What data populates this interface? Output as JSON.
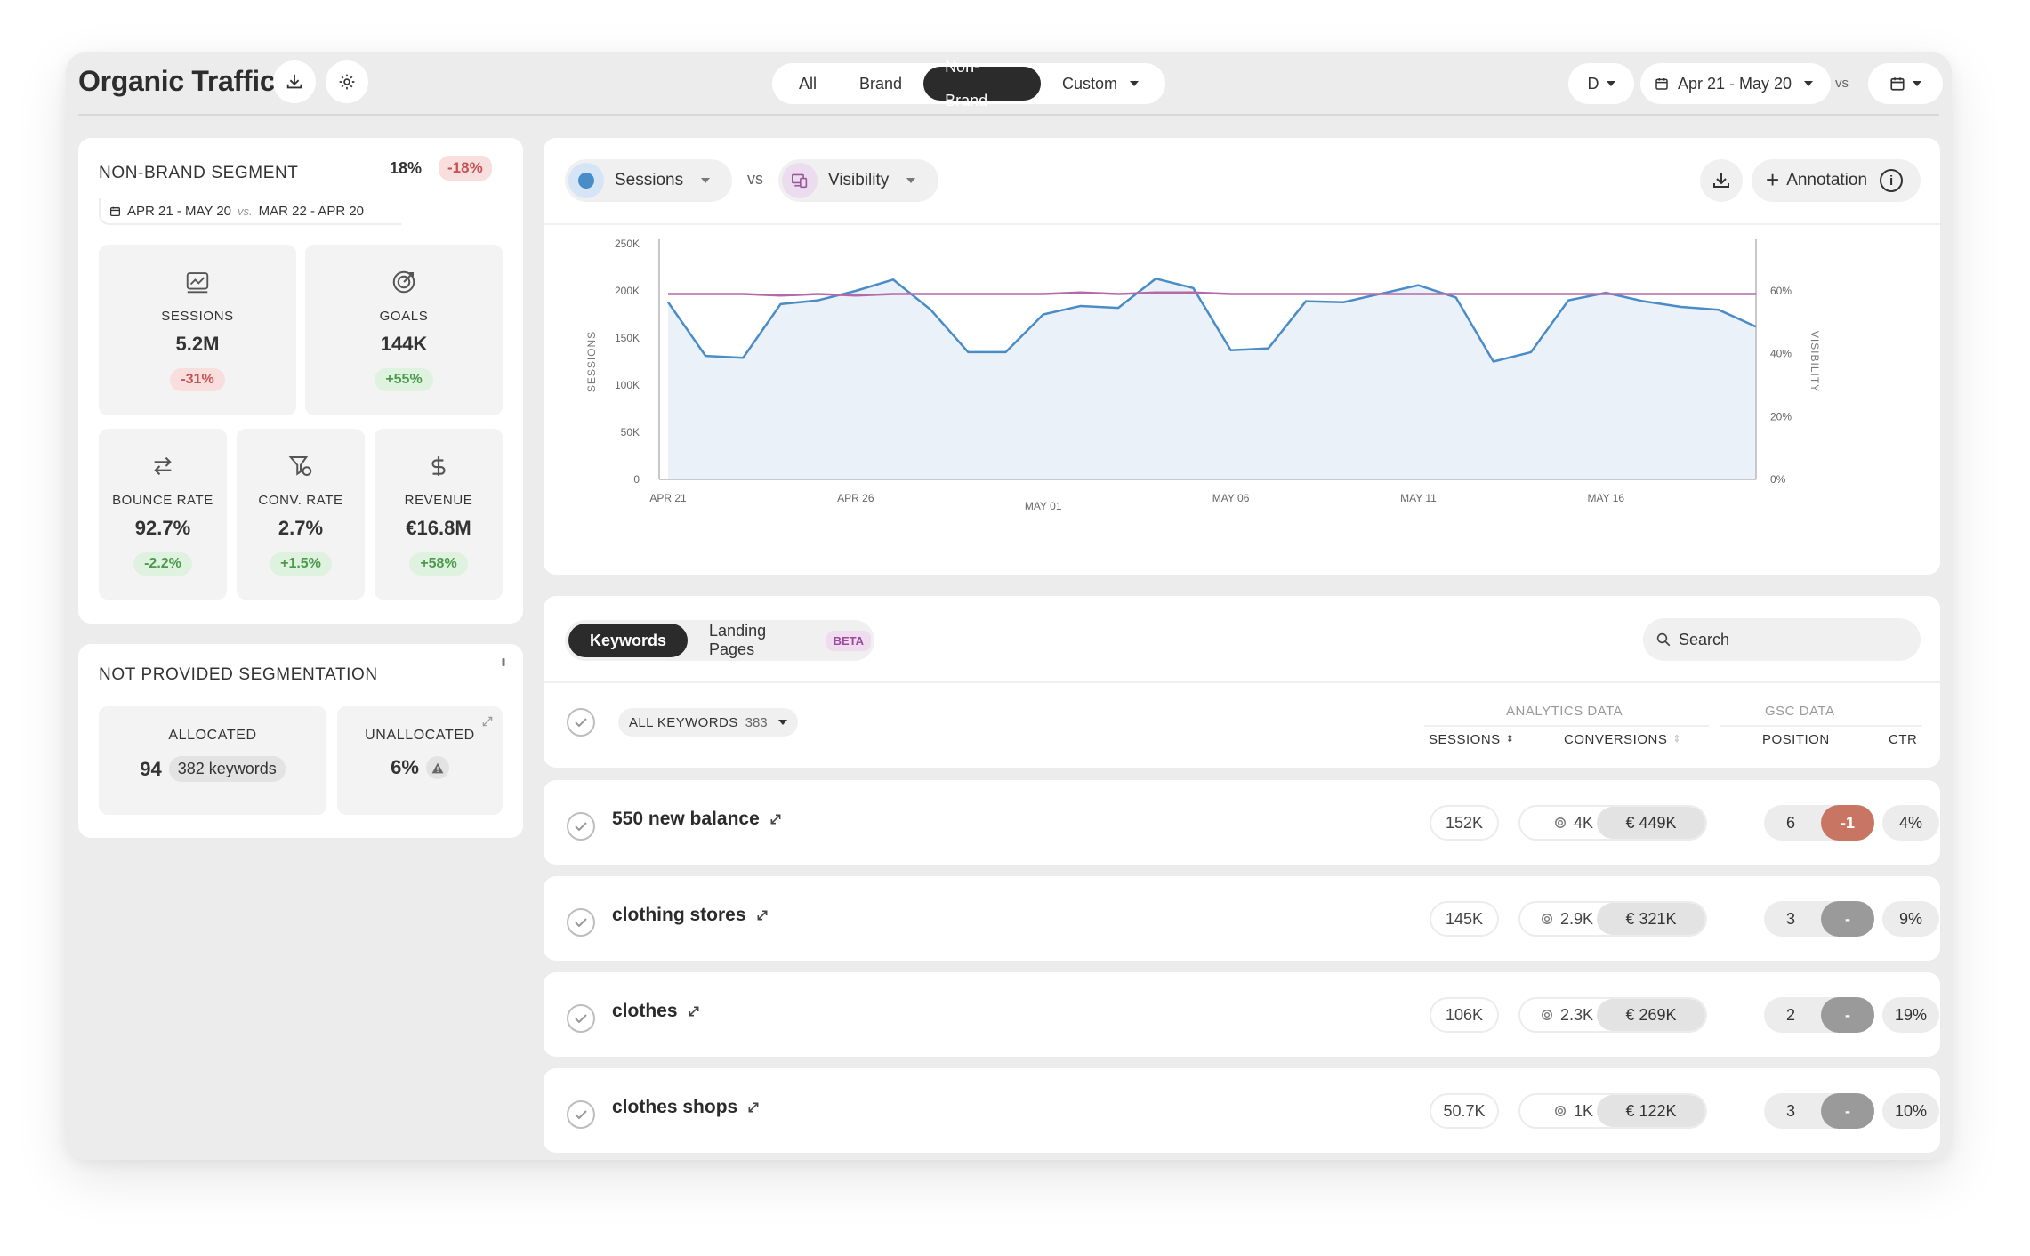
{
  "header": {
    "title": "Organic Traffic",
    "segments": [
      "All",
      "Brand",
      "Non-Brand",
      "Custom"
    ],
    "active_segment": "Non-Brand",
    "granularity": "D",
    "date_range": "Apr 21 - May 20",
    "vs_label": "vs"
  },
  "segment_card": {
    "title": "NON-BRAND SEGMENT",
    "share": "18%",
    "share_change": "-18%",
    "date_current": "APR 21 - MAY 20",
    "vs": "vs.",
    "date_previous": "MAR 22 - APR 20",
    "stats": [
      {
        "label": "SESSIONS",
        "value": "5.2M",
        "change": "-31%",
        "trend": "negative",
        "icon": "sessions-chart-icon"
      },
      {
        "label": "GOALS",
        "value": "144K",
        "change": "+55%",
        "trend": "positive",
        "icon": "goals-target-icon"
      },
      {
        "label": "BOUNCE RATE",
        "value": "92.7%",
        "change": "-2.2%",
        "trend": "positive",
        "icon": "bounce-arrows-icon"
      },
      {
        "label": "CONV. RATE",
        "value": "2.7%",
        "change": "+1.5%",
        "trend": "positive",
        "icon": "conversion-funnel-icon"
      },
      {
        "label": "REVENUE",
        "value": "€16.8M",
        "change": "+58%",
        "trend": "positive",
        "icon": "dollar-icon"
      }
    ]
  },
  "not_provided": {
    "title": "NOT PROVIDED SEGMENTATION",
    "allocated_label": "ALLOCATED",
    "allocated_value": "94",
    "allocated_keywords": "382 keywords",
    "unallocated_label": "UNALLOCATED",
    "unallocated_value": "6%"
  },
  "chart_toolbar": {
    "metric_left": "Sessions",
    "vs": "vs",
    "metric_right": "Visibility",
    "annotation_label": "Annotation"
  },
  "chart_data": {
    "type": "line",
    "x": [
      "Apr 21",
      "Apr 22",
      "Apr 23",
      "Apr 24",
      "Apr 25",
      "Apr 26",
      "Apr 27",
      "Apr 28",
      "Apr 29",
      "Apr 30",
      "May 01",
      "May 02",
      "May 03",
      "May 04",
      "May 05",
      "May 06",
      "May 07",
      "May 08",
      "May 09",
      "May 10",
      "May 11",
      "May 12",
      "May 13",
      "May 14",
      "May 15",
      "May 16",
      "May 17",
      "May 18",
      "May 19",
      "May 20"
    ],
    "x_tick_labels": [
      "APR 21",
      "APR 26",
      "MAY 01",
      "MAY 06",
      "MAY 11",
      "MAY 16"
    ],
    "series": [
      {
        "name": "Sessions",
        "axis": "left",
        "color": "#4a8cc8",
        "fill": "#eaf1f9",
        "values": [
          188000,
          131000,
          129000,
          186000,
          190000,
          200000,
          212000,
          180000,
          135000,
          135000,
          175000,
          184000,
          182000,
          213000,
          203000,
          137000,
          139000,
          189000,
          188000,
          197000,
          206000,
          193000,
          125000,
          135000,
          190000,
          198000,
          189000,
          183000,
          180000,
          162000
        ]
      },
      {
        "name": "Visibility",
        "axis": "right",
        "color": "#b46aa8",
        "values": [
          59,
          59,
          59,
          58.5,
          59,
          58.5,
          59,
          59,
          59,
          59,
          59,
          59.5,
          59,
          59.5,
          59.5,
          59,
          59,
          59,
          59,
          59,
          59,
          59,
          59,
          59,
          59,
          59,
          59,
          59,
          59,
          59
        ]
      }
    ],
    "ylabel": "SESSIONS",
    "y2label": "VISIBILITY",
    "y_ticks": [
      "0",
      "50K",
      "100K",
      "150K",
      "200K",
      "250K"
    ],
    "y2_ticks": [
      "0%",
      "20%",
      "40%",
      "60%"
    ],
    "ylim": [
      0,
      250000
    ],
    "y2lim": [
      0,
      75
    ]
  },
  "tabs": {
    "keywords": "Keywords",
    "landing_pages": "Landing Pages",
    "beta": "BETA",
    "search_placeholder": "Search"
  },
  "table_header": {
    "filter_label": "ALL KEYWORDS",
    "filter_count": "383",
    "analytics_group": "ANALYTICS DATA",
    "gsc_group": "GSC DATA",
    "col_sessions": "SESSIONS",
    "col_conversions": "CONVERSIONS",
    "col_position": "POSITION",
    "col_ctr": "CTR"
  },
  "rows": [
    {
      "keyword": "550 new balance",
      "sessions": "152K",
      "conversions": "4K",
      "revenue": "€ 449K",
      "position": "6",
      "pos_change": "-1",
      "pos_trend": "down",
      "ctr": "4%"
    },
    {
      "keyword": "clothing stores",
      "sessions": "145K",
      "conversions": "2.9K",
      "revenue": "€ 321K",
      "position": "3",
      "pos_change": "-",
      "pos_trend": "flat",
      "ctr": "9%"
    },
    {
      "keyword": "clothes",
      "sessions": "106K",
      "conversions": "2.3K",
      "revenue": "€ 269K",
      "position": "2",
      "pos_change": "-",
      "pos_trend": "flat",
      "ctr": "19%"
    },
    {
      "keyword": "clothes shops",
      "sessions": "50.7K",
      "conversions": "1K",
      "revenue": "€ 122K",
      "position": "3",
      "pos_change": "-",
      "pos_trend": "flat",
      "ctr": "10%"
    }
  ]
}
